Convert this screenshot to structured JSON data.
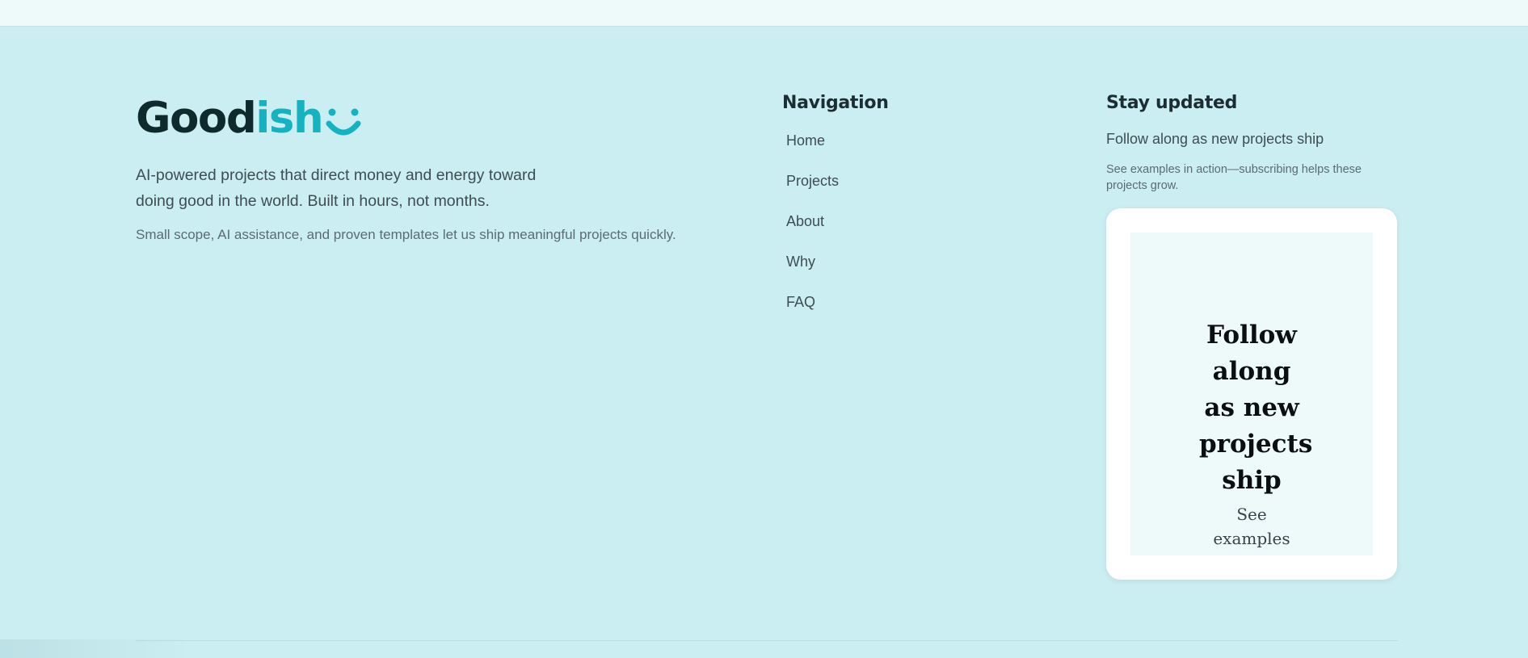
{
  "brand": {
    "logo_part1": "Good",
    "logo_part2": "ish",
    "logo_icon": "smile-icon",
    "tagline": "AI-powered projects that direct money and energy toward doing good in the world. Built in hours, not months.",
    "subline": "Small scope, AI assistance, and proven templates let us ship meaningful projects quickly."
  },
  "navigation": {
    "heading": "Navigation",
    "items": [
      {
        "label": "Home"
      },
      {
        "label": "Projects"
      },
      {
        "label": "About"
      },
      {
        "label": "Why"
      },
      {
        "label": "FAQ"
      }
    ]
  },
  "updates": {
    "heading": "Stay updated",
    "lead": "Follow along as new projects ship",
    "note": "See examples in action—subscribing helps these projects grow.",
    "embed": {
      "title": "Follow along as new projects ship",
      "link": "See examples"
    }
  },
  "colors": {
    "background": "#cbeef2",
    "accent": "#15b3c2",
    "logo_dark": "#0f2a2c",
    "card": "#ffffff"
  }
}
